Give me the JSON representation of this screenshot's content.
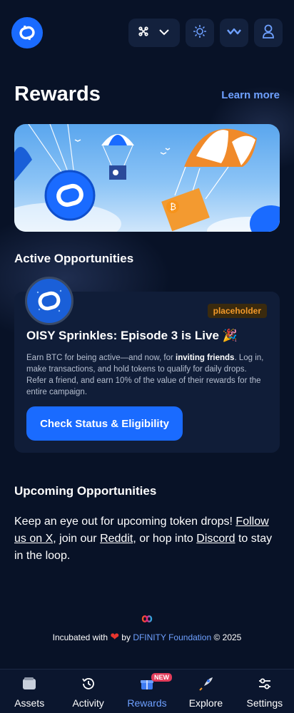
{
  "header": {
    "icons": [
      "oisy-logo-icon",
      "network-icon",
      "chevron-down-icon",
      "sun-icon",
      "wave-icon",
      "user-icon"
    ]
  },
  "page": {
    "title": "Rewards",
    "learn_more": "Learn more"
  },
  "active": {
    "heading": "Active Opportunities",
    "badge": "placeholder",
    "title": "OISY Sprinkles: Episode 3 is Live 🎉",
    "desc_part1": "Earn BTC for being active—and now, for ",
    "desc_bold": "inviting friends",
    "desc_part2": ". Log in, make transactions, and hold tokens to qualify for daily drops. Refer a friend, and earn 10% of the value of their rewards for the entire campaign.",
    "cta": "Check Status & Eligibility"
  },
  "upcoming": {
    "heading": "Upcoming Opportunities",
    "text1": "Keep an eye out for upcoming token drops! ",
    "link_x": "Follow us on X",
    "text2": ", join our ",
    "link_reddit": "Reddit",
    "text3": ", or hop into ",
    "link_discord": "Discord",
    "text4": " to stay in the loop."
  },
  "footer": {
    "prefix": "Incubated with",
    "heart": "❤",
    "by": "by",
    "org": "DFINITY Foundation",
    "year": "© 2025"
  },
  "tabs": [
    {
      "label": "Assets",
      "icon": "wallet-icon"
    },
    {
      "label": "Activity",
      "icon": "history-icon"
    },
    {
      "label": "Rewards",
      "icon": "gift-icon",
      "badge": "NEW",
      "active": true
    },
    {
      "label": "Explore",
      "icon": "rocket-icon"
    },
    {
      "label": "Settings",
      "icon": "sliders-icon"
    }
  ],
  "colors": {
    "background": "#081227",
    "accent": "#1a6bff",
    "link": "#6ea0ff",
    "card": "#101d38"
  }
}
